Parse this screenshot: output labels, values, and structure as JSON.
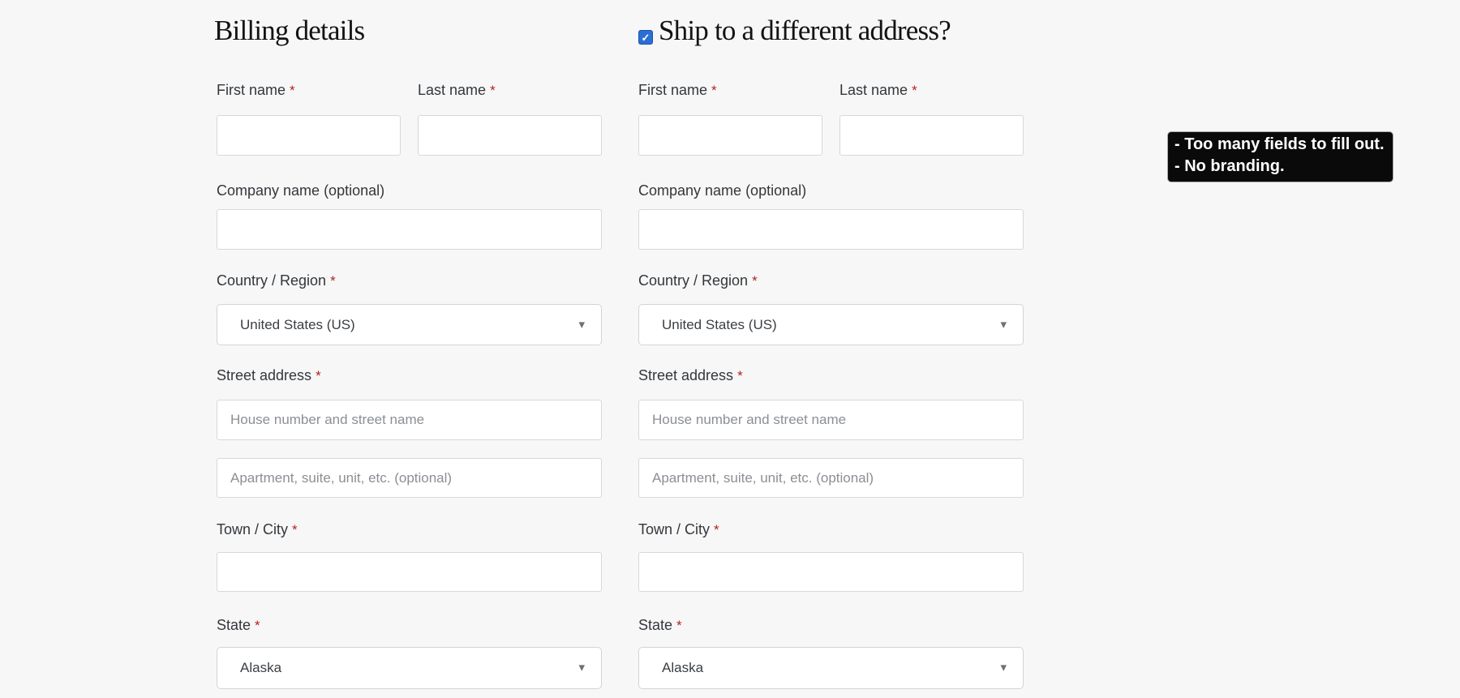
{
  "page": {
    "background": "#f7f7f7"
  },
  "billing": {
    "title": "Billing details"
  },
  "shipping": {
    "title": "Ship to a different address?",
    "checkbox_checked": true
  },
  "form": {
    "required_marker": "*",
    "first_name": {
      "label": "First name",
      "value": ""
    },
    "last_name": {
      "label": "Last name",
      "value": ""
    },
    "company": {
      "label": "Company name (optional)",
      "value": ""
    },
    "country": {
      "label": "Country / Region",
      "value": "United States (US)"
    },
    "street": {
      "label": "Street address",
      "placeholder1": "House number and street name",
      "placeholder2": "Apartment, suite, unit, etc. (optional)",
      "value1": "",
      "value2": ""
    },
    "city": {
      "label": "Town / City",
      "value": ""
    },
    "state": {
      "label": "State",
      "value": "Alaska"
    }
  },
  "annotation": {
    "line1": "- Too many fields to fill out.",
    "line2": "- No branding."
  },
  "icons": {
    "checkmark": "✓",
    "caret_down": "▾"
  },
  "colors": {
    "accent_blue": "#2b6fd4",
    "required_red": "#b22222",
    "annotation_bg": "#0a0a0a",
    "annotation_text": "#ffffff"
  }
}
